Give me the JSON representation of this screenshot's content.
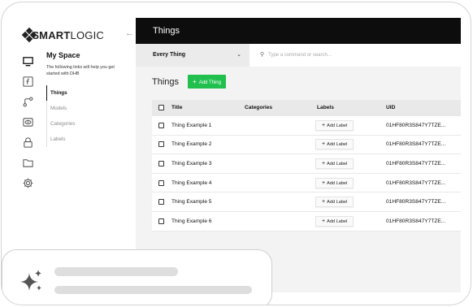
{
  "brand": {
    "logo_bold": "SMART",
    "logo_light": "LOGIC"
  },
  "rail_icons": [
    "monitor-icon",
    "function-icon",
    "branch-icon",
    "eye-icon",
    "lock-icon",
    "folder-icon",
    "gear-icon"
  ],
  "subnav": {
    "title": "My Space",
    "description": "The following links will help you get started with DHB",
    "items": [
      "Things",
      "Models",
      "Categories",
      "Labels"
    ],
    "active": "Things"
  },
  "topbar": {
    "title": "Things"
  },
  "command": {
    "selector": "Every Thing",
    "placeholder": "Type a command or search..."
  },
  "page": {
    "title": "Things",
    "add_button": "Add Thing"
  },
  "table": {
    "columns": [
      "Title",
      "Categories",
      "Labels",
      "UID"
    ],
    "add_label": "Add Label",
    "rows": [
      {
        "title": "Thing Example 1",
        "uid": "01HF80R3S847Y7TZE..."
      },
      {
        "title": "Thing Example 2",
        "uid": "01HF80R3S847Y7TZE..."
      },
      {
        "title": "Thing Example 3",
        "uid": "01HF80R3S847Y7TZE..."
      },
      {
        "title": "Thing Example 4",
        "uid": "01HF80R3S847Y7TZE..."
      },
      {
        "title": "Thing Example 5",
        "uid": "01HF80R3S847Y7TZE..."
      },
      {
        "title": "Thing Example 6",
        "uid": "01HF80R3S847Y7TZE..."
      }
    ]
  },
  "colors": {
    "accent": "#21c04e",
    "topbar": "#0d0d0d",
    "panel": "#f3f3f3"
  }
}
